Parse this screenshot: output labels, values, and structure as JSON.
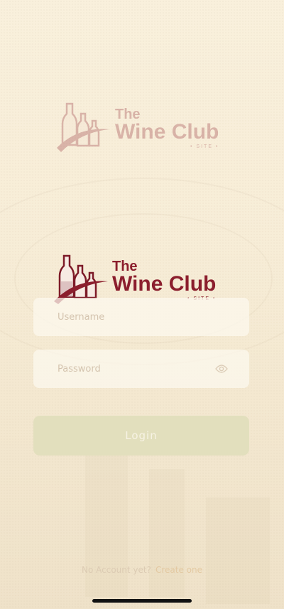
{
  "logo": {
    "the": "The",
    "name": "Wine Club",
    "sub": "• SITE •"
  },
  "form": {
    "username_placeholder": "Username",
    "password_placeholder": "Password",
    "login_label": "Login"
  },
  "footer": {
    "question": "No Account yet?",
    "link": "Create one"
  },
  "colors": {
    "brand": "#8b1e2d",
    "button": "#e2dfbd",
    "background": "#f8efd9"
  },
  "icons": {
    "password_toggle": "eye-icon"
  }
}
